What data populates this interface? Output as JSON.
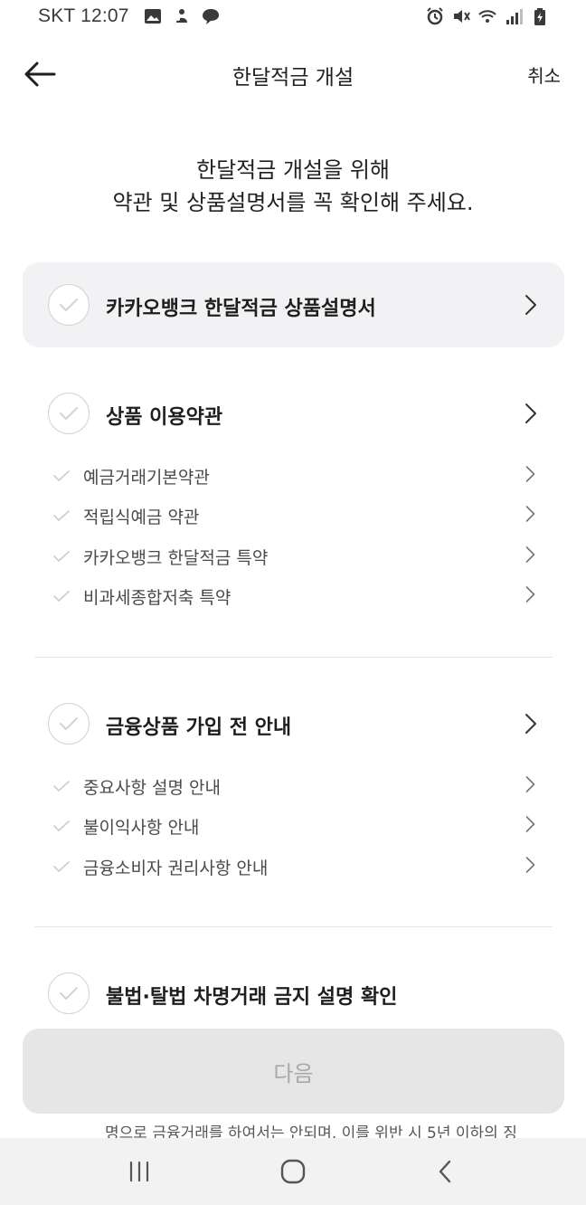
{
  "status_bar": {
    "carrier": "SKT",
    "time": "12:07",
    "left_icons": [
      "image-icon",
      "app-icon",
      "chat-icon"
    ],
    "right_icons": [
      "alarm-icon",
      "mute-icon",
      "wifi-icon",
      "signal-icon",
      "battery-charging-icon"
    ]
  },
  "header": {
    "title": "한달적금 개설",
    "cancel_label": "취소",
    "back_icon": "back-arrow-icon"
  },
  "intro": {
    "line1": "한달적금 개설을 위해",
    "line2": "약관 및 상품설명서를 꼭 확인해 주세요."
  },
  "sections": [
    {
      "label": "카카오뱅크 한달적금 상품설명서",
      "items": []
    },
    {
      "label": "상품 이용약관",
      "items": [
        {
          "label": "예금거래기본약관"
        },
        {
          "label": "적립식예금 약관"
        },
        {
          "label": "카카오뱅크 한달적금 특약"
        },
        {
          "label": "비과세종합저축 특약"
        }
      ]
    },
    {
      "label": "금융상품 가입 전 안내",
      "items": [
        {
          "label": "중요사항 설명 안내"
        },
        {
          "label": "불이익사항 안내"
        },
        {
          "label": "금융소비자 권리사항 안내"
        }
      ]
    },
    {
      "label": "불법·탈법 차명거래 금지 설명 확인",
      "items": []
    }
  ],
  "next_button": {
    "label": "다음"
  },
  "footer_peek": "명으로 금융거래를 하여서는 안되며, 이를 위반 시 5년 이하의 징",
  "nav_bar": {
    "icons": [
      "recent-apps-icon",
      "home-icon",
      "back-icon"
    ]
  },
  "colors": {
    "highlight_bg": "#f2f2f4",
    "button_disabled_bg": "#e6e6e6",
    "button_disabled_text": "#a9a9a9",
    "check_gray": "#d3d3d3"
  }
}
